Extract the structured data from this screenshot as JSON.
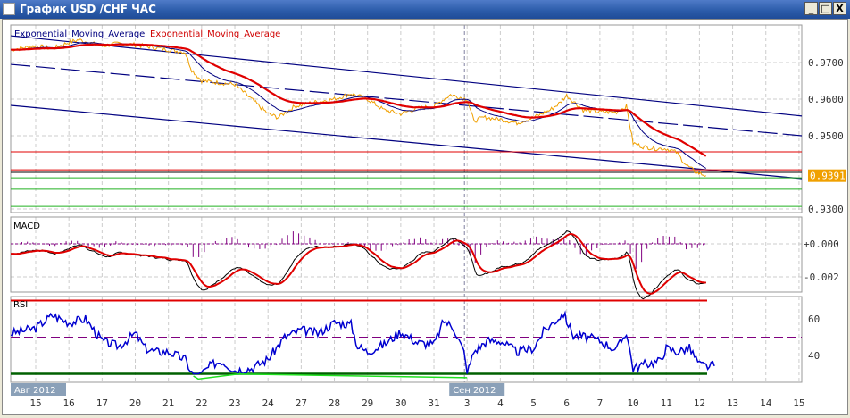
{
  "window": {
    "title": "График USD /CHF  ЧАС",
    "minimize": "_",
    "maximize": "□",
    "close": "X"
  },
  "legend": {
    "ema_fast": "Exponential_Moving_Average",
    "ema_slow": "Exponential_Moving_Average"
  },
  "panes": {
    "macd_label": "MACD",
    "rsi_label": "RSI"
  },
  "colors": {
    "price": "#f0a000",
    "ema_fast": "#000080",
    "ema_slow": "#e00000",
    "channel": "#000080",
    "rsi": "#0000d0",
    "rsi_oversold": "#20e020",
    "hist": "#800080",
    "current_price_bg": "#f0a000"
  },
  "chart_data": {
    "type": "line",
    "x_labels": [
      "15",
      "16",
      "17",
      "20",
      "21",
      "22",
      "23",
      "24",
      "27",
      "28",
      "29",
      "30",
      "31",
      "3",
      "4",
      "5",
      "6",
      "7",
      "10",
      "11",
      "12",
      "13",
      "14",
      "15"
    ],
    "month_labels": [
      {
        "text": "Авг 2012",
        "at_index": 0
      },
      {
        "text": "Сен 2012",
        "at_index": 13
      }
    ],
    "price": {
      "yticks": [
        "0.9700",
        "0.9600",
        "0.9500",
        "0.9300"
      ],
      "ytick_values": [
        0.97,
        0.96,
        0.95,
        0.93
      ],
      "current_price": "0.9391",
      "series": [
        [
          -0.75,
          0.9735
        ],
        [
          0,
          0.9745
        ],
        [
          0.5,
          0.9738
        ],
        [
          1,
          0.9755
        ],
        [
          1.3,
          0.9762
        ],
        [
          2,
          0.9745
        ],
        [
          2.5,
          0.9752
        ],
        [
          3,
          0.9748
        ],
        [
          3.5,
          0.9742
        ],
        [
          4,
          0.9735
        ],
        [
          4.5,
          0.9728
        ],
        [
          4.7,
          0.968
        ],
        [
          5,
          0.965
        ],
        [
          5.5,
          0.9645
        ],
        [
          6,
          0.964
        ],
        [
          6.5,
          0.96
        ],
        [
          7,
          0.956
        ],
        [
          7.3,
          0.955
        ],
        [
          7.8,
          0.958
        ],
        [
          8.3,
          0.959
        ],
        [
          9,
          0.96
        ],
        [
          9.5,
          0.9615
        ],
        [
          10,
          0.96
        ],
        [
          10.5,
          0.957
        ],
        [
          11,
          0.956
        ],
        [
          11.5,
          0.9575
        ],
        [
          12,
          0.958
        ],
        [
          12.3,
          0.96
        ],
        [
          12.5,
          0.9612
        ],
        [
          13,
          0.96
        ],
        [
          13.2,
          0.954
        ],
        [
          13.5,
          0.955
        ],
        [
          14,
          0.9545
        ],
        [
          14.5,
          0.9535
        ],
        [
          15,
          0.955
        ],
        [
          15.5,
          0.957
        ],
        [
          15.8,
          0.959
        ],
        [
          16,
          0.961
        ],
        [
          16.5,
          0.957
        ],
        [
          17,
          0.9565
        ],
        [
          17.5,
          0.9565
        ],
        [
          17.8,
          0.958
        ],
        [
          18,
          0.948
        ],
        [
          18.3,
          0.947
        ],
        [
          18.7,
          0.9465
        ],
        [
          19,
          0.9465
        ],
        [
          19.3,
          0.9455
        ],
        [
          19.6,
          0.942
        ],
        [
          19.9,
          0.94
        ],
        [
          20.2,
          0.9391
        ]
      ],
      "channel_lines": [
        {
          "from": [
            -0.75,
            0.9773
          ],
          "to": [
            23,
            0.9554
          ],
          "dashed": false
        },
        {
          "from": [
            -0.75,
            0.9695
          ],
          "to": [
            23,
            0.95
          ],
          "dashed": true
        },
        {
          "from": [
            -0.75,
            0.9583
          ],
          "to": [
            23,
            0.9383
          ],
          "dashed": false
        }
      ],
      "levels": [
        {
          "value": 0.9456,
          "color": "#e00000"
        },
        {
          "value": 0.9407,
          "color": "#e00000"
        },
        {
          "value": 0.94,
          "color": "#000000"
        },
        {
          "value": 0.9385,
          "color": "#20b020"
        },
        {
          "value": 0.9354,
          "color": "#20b020"
        },
        {
          "value": 0.9307,
          "color": "#20b020"
        }
      ]
    },
    "macd": {
      "yticks": [
        "+0.000",
        "-0.002"
      ],
      "ytick_values": [
        0,
        -0.002
      ]
    },
    "rsi": {
      "yticks": [
        "60",
        "40"
      ],
      "ytick_values": [
        60,
        40
      ],
      "levels": {
        "upper": 70,
        "mid": 50,
        "lower": 30
      },
      "series": [
        [
          -0.75,
          52
        ],
        [
          0,
          55
        ],
        [
          0.5,
          62
        ],
        [
          1,
          58
        ],
        [
          1.5,
          60
        ],
        [
          2,
          48
        ],
        [
          2.5,
          45
        ],
        [
          3,
          52
        ],
        [
          3.3,
          44
        ],
        [
          3.6,
          42
        ],
        [
          4,
          42
        ],
        [
          4.5,
          38
        ],
        [
          4.8,
          27
        ],
        [
          5,
          30
        ],
        [
          5.3,
          35
        ],
        [
          5.6,
          37
        ],
        [
          6,
          32
        ],
        [
          6.5,
          33
        ],
        [
          7,
          38
        ],
        [
          7.5,
          50
        ],
        [
          8,
          54
        ],
        [
          8.5,
          52
        ],
        [
          9,
          58
        ],
        [
          9.5,
          57
        ],
        [
          9.7,
          45
        ],
        [
          10,
          42
        ],
        [
          10.5,
          46
        ],
        [
          11,
          53
        ],
        [
          11.5,
          47
        ],
        [
          12,
          46
        ],
        [
          12.3,
          59
        ],
        [
          12.6,
          55
        ],
        [
          12.9,
          42
        ],
        [
          13,
          30
        ],
        [
          13.2,
          42
        ],
        [
          13.6,
          48
        ],
        [
          14,
          48
        ],
        [
          14.5,
          42
        ],
        [
          15,
          44
        ],
        [
          15.3,
          53
        ],
        [
          15.6,
          58
        ],
        [
          15.9,
          63
        ],
        [
          16.2,
          51
        ],
        [
          16.6,
          50
        ],
        [
          17,
          48
        ],
        [
          17.5,
          43
        ],
        [
          17.8,
          53
        ],
        [
          18,
          33
        ],
        [
          18.3,
          35
        ],
        [
          18.8,
          37
        ],
        [
          19,
          44
        ],
        [
          19.3,
          42
        ],
        [
          19.7,
          44
        ],
        [
          20,
          35
        ],
        [
          20.3,
          34
        ],
        [
          20.5,
          35
        ]
      ]
    }
  }
}
